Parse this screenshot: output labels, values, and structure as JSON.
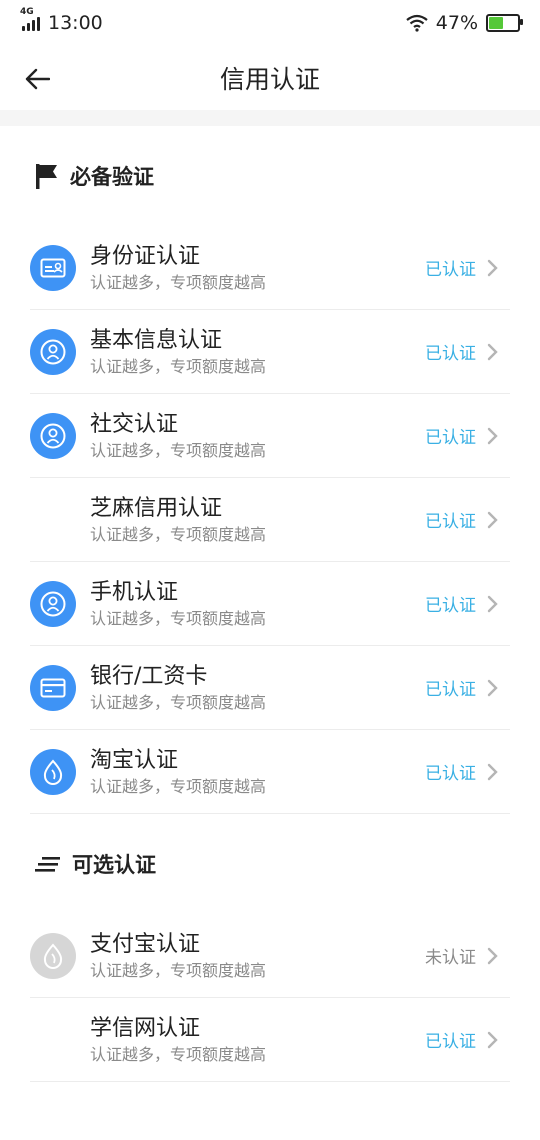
{
  "status_bar": {
    "network": "4G",
    "time": "13:00",
    "battery": "47%",
    "battery_level": 0.47
  },
  "header": {
    "title": "信用认证"
  },
  "sections": [
    {
      "title": "必备验证",
      "items": [
        {
          "title": "身份证认证",
          "subtitle": "认证越多，专项额度越高",
          "status": "已认证",
          "icon": "id-card-icon"
        },
        {
          "title": "基本信息认证",
          "subtitle": "认证越多，专项额度越高",
          "status": "已认证",
          "icon": "person-icon"
        },
        {
          "title": "社交认证",
          "subtitle": "认证越多，专项额度越高",
          "status": "已认证",
          "icon": "person-icon"
        },
        {
          "title": "芝麻信用认证",
          "subtitle": "认证越多，专项额度越高",
          "status": "已认证",
          "icon": ""
        },
        {
          "title": "手机认证",
          "subtitle": "认证越多，专项额度越高",
          "status": "已认证",
          "icon": "person-icon"
        },
        {
          "title": "银行/工资卡",
          "subtitle": "认证越多，专项额度越高",
          "status": "已认证",
          "icon": "bank-card-icon"
        },
        {
          "title": "淘宝认证",
          "subtitle": "认证越多，专项额度越高",
          "status": "已认证",
          "icon": "drop-icon"
        }
      ]
    },
    {
      "title": "可选认证",
      "items": [
        {
          "title": "支付宝认证",
          "subtitle": "认证越多，专项额度越高",
          "status": "未认证",
          "icon": "drop-icon"
        },
        {
          "title": "学信网认证",
          "subtitle": "认证越多，专项额度越高",
          "status": "已认证",
          "icon": ""
        }
      ]
    }
  ],
  "colors": {
    "accent_blue": "#3e93f5",
    "status_done": "#3ab0e4",
    "status_todo": "#8a8a8a",
    "icon_disabled": "#d6d6d6"
  }
}
